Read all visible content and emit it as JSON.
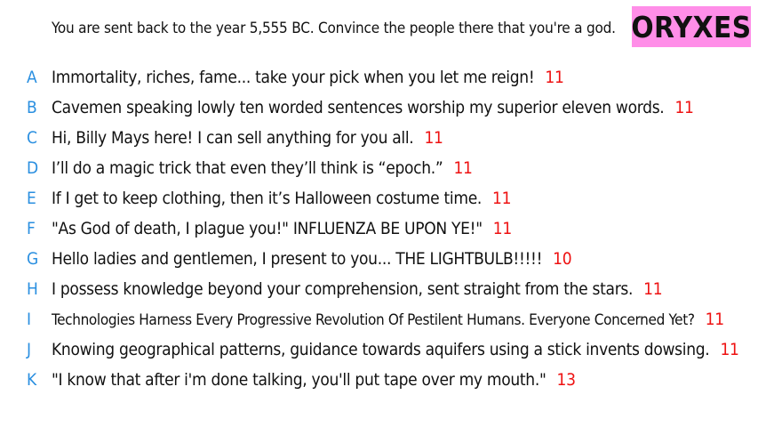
{
  "prompt": "You are sent back to the year 5,555 BC. Convince the people there that you're a god.",
  "badge": {
    "text": "ORYXES",
    "color": "#ff8ee8"
  },
  "colors": {
    "letter": "#2a8fe0",
    "count": "#ee1111"
  },
  "answers": [
    {
      "letter": "A",
      "text": "Immortality, riches, fame... take your pick when you let me reign!",
      "count": "11"
    },
    {
      "letter": "B",
      "text": "Cavemen speaking lowly ten worded sentences worship my superior eleven words.",
      "count": "11"
    },
    {
      "letter": "C",
      "text": "Hi, Billy Mays here! I can sell anything for you all.",
      "count": "11"
    },
    {
      "letter": "D",
      "text": "I’ll do a magic trick that even they’ll think is “epoch.”",
      "count": "11"
    },
    {
      "letter": "E",
      "text": "If I get to keep clothing, then it’s Halloween costume time.",
      "count": "11"
    },
    {
      "letter": "F",
      "text": "\"As God of death, I plague you!\" INFLUENZA BE UPON YE!\"",
      "count": "11"
    },
    {
      "letter": "G",
      "text": "Hello ladies and gentlemen, I present to you... THE LIGHTBULB!!!!!",
      "count": "10"
    },
    {
      "letter": "H",
      "text": "I possess knowledge beyond your comprehension, sent straight from the stars.",
      "count": "11"
    },
    {
      "letter": "I",
      "text": "Technologies Harness Every Progressive Revolution Of Pestilent Humans. Everyone Concerned Yet?",
      "count": "11"
    },
    {
      "letter": "J",
      "text": "Knowing geographical patterns, guidance towards aquifers using a stick invents dowsing.",
      "count": "11"
    },
    {
      "letter": "K",
      "text": "\"I know that after i'm done talking, you'll put tape over my mouth.\"",
      "count": "13"
    }
  ]
}
